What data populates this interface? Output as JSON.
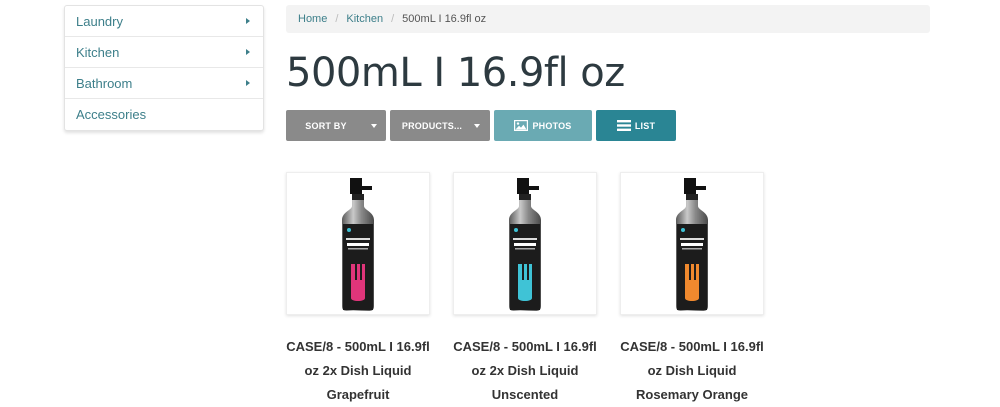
{
  "sidebar": {
    "items": [
      {
        "label": "Laundry",
        "has_arrow": true
      },
      {
        "label": "Kitchen",
        "has_arrow": true
      },
      {
        "label": "Bathroom",
        "has_arrow": true
      },
      {
        "label": "Accessories",
        "has_arrow": false
      }
    ]
  },
  "breadcrumb": {
    "home": "Home",
    "kitchen": "Kitchen",
    "current": "500mL I 16.9fl oz",
    "separator": "/"
  },
  "page_title": "500mL I 16.9fl oz",
  "toolbar": {
    "sort_label": "SORT BY",
    "products_label": "PRODUCTS...",
    "photos_label": "PHOTOS",
    "list_label": "LIST"
  },
  "products": [
    {
      "name": "CASE/8 - 500mL I 16.9fl oz 2x Dish Liquid Grapefruit",
      "accent": "#e0357a",
      "label_icon": "fork-icon"
    },
    {
      "name": "CASE/8 - 500mL I 16.9fl oz 2x Dish Liquid Unscented",
      "accent": "#3fc3d6",
      "label_icon": "fork-icon"
    },
    {
      "name": "CASE/8 - 500mL I 16.9fl oz Dish Liquid Rosemary Orange",
      "accent": "#f0892e",
      "label_icon": "fork-icon"
    }
  ],
  "colors": {
    "link": "#3d7f8a",
    "btn_gray": "#8a8a8a",
    "btn_photos": "#6aaab3",
    "btn_list": "#2a8594"
  }
}
